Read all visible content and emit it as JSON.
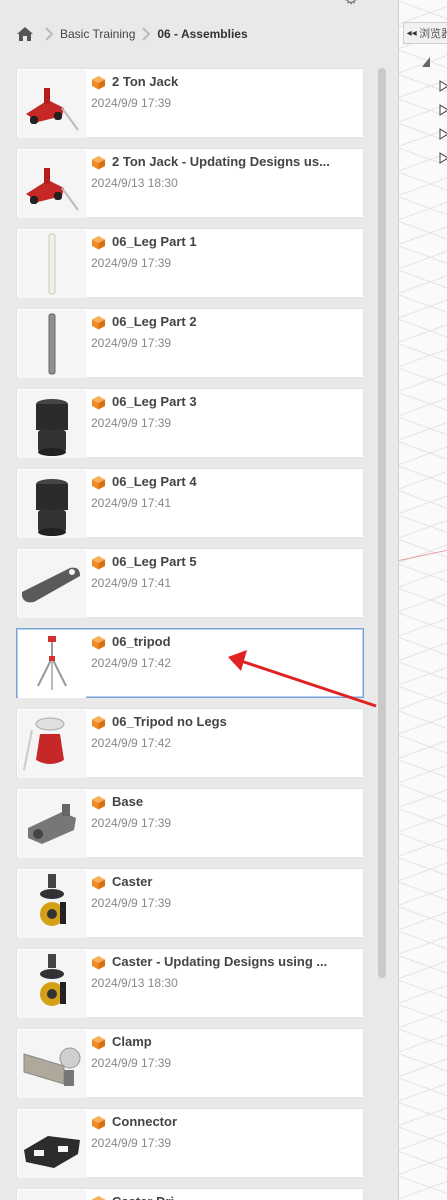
{
  "breadcrumb": {
    "home_icon": "home-icon",
    "items": [
      "Basic Training",
      "06 - Assemblies"
    ]
  },
  "files": [
    {
      "title": "2 Ton Jack",
      "date": "2024/9/9 17:39",
      "thumb": "jack"
    },
    {
      "title": "2 Ton Jack - Updating Designs us...",
      "date": "2024/9/13 18:30",
      "thumb": "jack"
    },
    {
      "title": "06_Leg Part 1",
      "date": "2024/9/9 17:39",
      "thumb": "rod-light"
    },
    {
      "title": "06_Leg Part 2",
      "date": "2024/9/9 17:39",
      "thumb": "rod-grey"
    },
    {
      "title": "06_Leg Part 3",
      "date": "2024/9/9 17:39",
      "thumb": "cylinder"
    },
    {
      "title": "06_Leg Part 4",
      "date": "2024/9/9 17:41",
      "thumb": "cylinder"
    },
    {
      "title": "06_Leg Part 5",
      "date": "2024/9/9 17:41",
      "thumb": "plate"
    },
    {
      "title": "06_tripod",
      "date": "2024/9/9 17:42",
      "thumb": "tripod",
      "selected": true
    },
    {
      "title": "06_Tripod no Legs",
      "date": "2024/9/9 17:42",
      "thumb": "tripod-head"
    },
    {
      "title": "Base",
      "date": "2024/9/9 17:39",
      "thumb": "base"
    },
    {
      "title": "Caster",
      "date": "2024/9/9 17:39",
      "thumb": "caster"
    },
    {
      "title": "Caster - Updating Designs using ...",
      "date": "2024/9/13 18:30",
      "thumb": "caster"
    },
    {
      "title": "Clamp",
      "date": "2024/9/9 17:39",
      "thumb": "clamp"
    },
    {
      "title": "Connector",
      "date": "2024/9/9 17:39",
      "thumb": "connector"
    },
    {
      "title": "Caster Dri...",
      "date": "",
      "thumb": "blank"
    }
  ],
  "right_pane": {
    "collapse_icon": "double-left-arrow-icon",
    "label": "浏览器"
  },
  "colors": {
    "cube_orange": "#f08a24",
    "selection_border": "#7aa3d6",
    "arrow_red": "#e02222"
  }
}
